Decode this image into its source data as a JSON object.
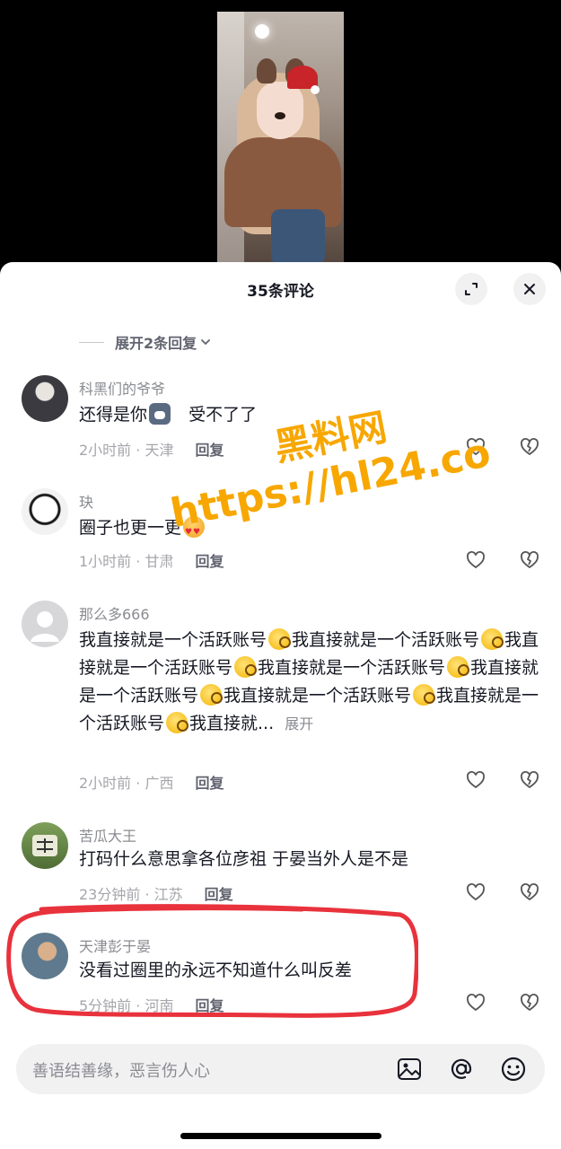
{
  "sheet": {
    "title": "35条评论",
    "expand_label": "展开2条回复"
  },
  "watermark": {
    "line1": "黑料网",
    "line2": "https://hl24.co"
  },
  "comments": [
    {
      "name": "科黑们的爷爷",
      "text_a": "还得是你",
      "text_b": "受不了了",
      "time": "2小时前 · 天津",
      "reply": "回复"
    },
    {
      "name": "玦",
      "text_a": "圈子也更一更",
      "time": "1小时前 · 甘肃",
      "reply": "回复"
    },
    {
      "name": "那么多666",
      "seg": "我直接就是一个活跃账号",
      "more": "展开",
      "time": "2小时前 · 广西",
      "reply": "回复"
    },
    {
      "name": "苦瓜大王",
      "text_a": "打码什么意思拿各位彦祖 于晏当外人是不是",
      "time": "23分钟前 · 江苏",
      "reply": "回复"
    },
    {
      "name": "天津彭于晏",
      "text_a": "没看过圈里的永远不知道什么叫反差",
      "time": "5分钟前 · 河南",
      "reply": "回复"
    }
  ],
  "input": {
    "placeholder": "善语结善缘，恶言伤人心"
  }
}
